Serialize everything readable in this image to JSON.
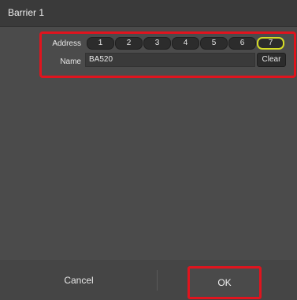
{
  "window": {
    "title": "Barrier 1"
  },
  "address": {
    "label": "Address",
    "buttons": [
      "1",
      "2",
      "3",
      "4",
      "5",
      "6",
      "7"
    ],
    "selected": "7"
  },
  "name": {
    "label": "Name",
    "value": "BA520",
    "clear_label": "Clear"
  },
  "footer": {
    "cancel_label": "Cancel",
    "ok_label": "OK"
  },
  "colors": {
    "highlight_border": "#e0141e",
    "selected_outline": "#d5dc26"
  }
}
